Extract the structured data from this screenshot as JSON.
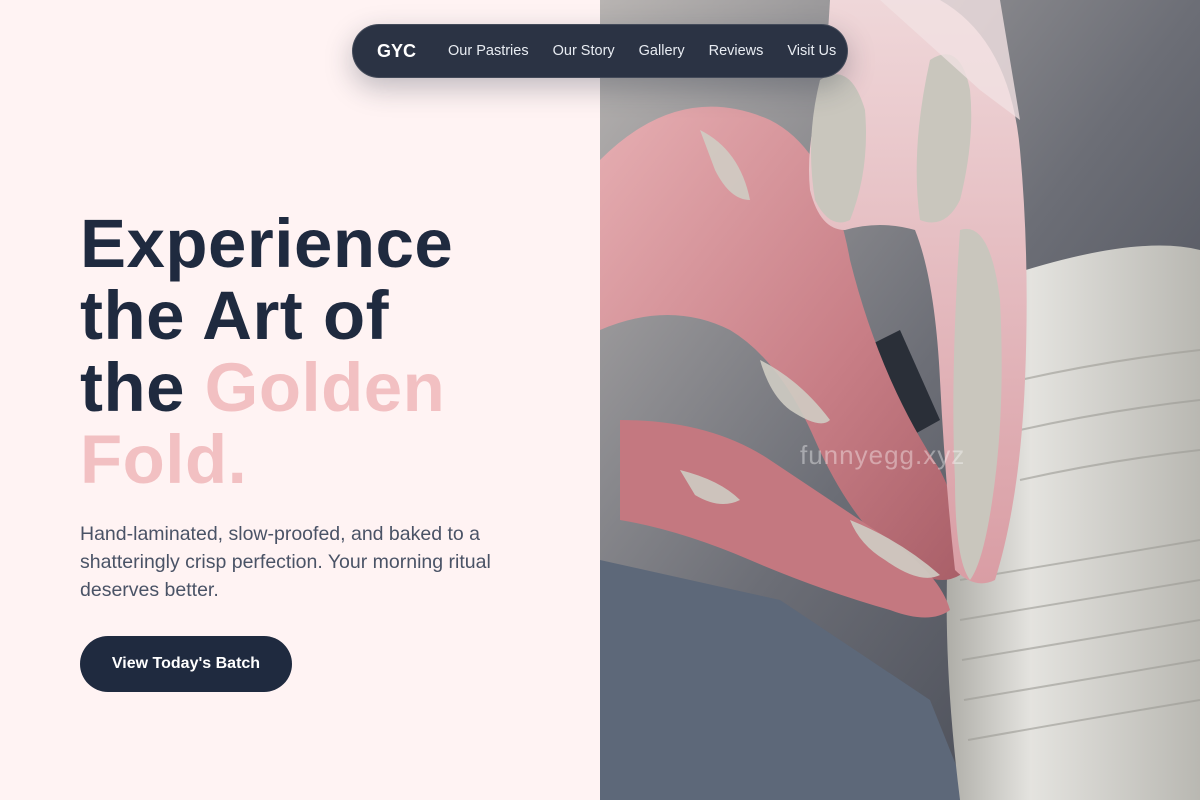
{
  "nav": {
    "brand": "GYC",
    "links": [
      "Our Pastries",
      "Our Story",
      "Gallery",
      "Reviews",
      "Visit Us"
    ]
  },
  "hero": {
    "title_line1": "Experience",
    "title_line2": "the Art of",
    "title_line3_prefix": "the ",
    "title_accent_1": "Golden",
    "title_accent_2": "Fold.",
    "subtitle": "Hand-laminated, slow-proofed, and baked to a shatteringly crisp perfection. Your morning ritual deserves better.",
    "cta_label": "View Today's Batch"
  },
  "image": {
    "watermark": "funnyegg.xyz",
    "subject": "hands-shaping-clay-bowl"
  },
  "colors": {
    "background": "#fff3f3",
    "navy": "#1f2a3f",
    "accent_pink": "#f2c0c2",
    "nav_bg": "#2b3344"
  }
}
